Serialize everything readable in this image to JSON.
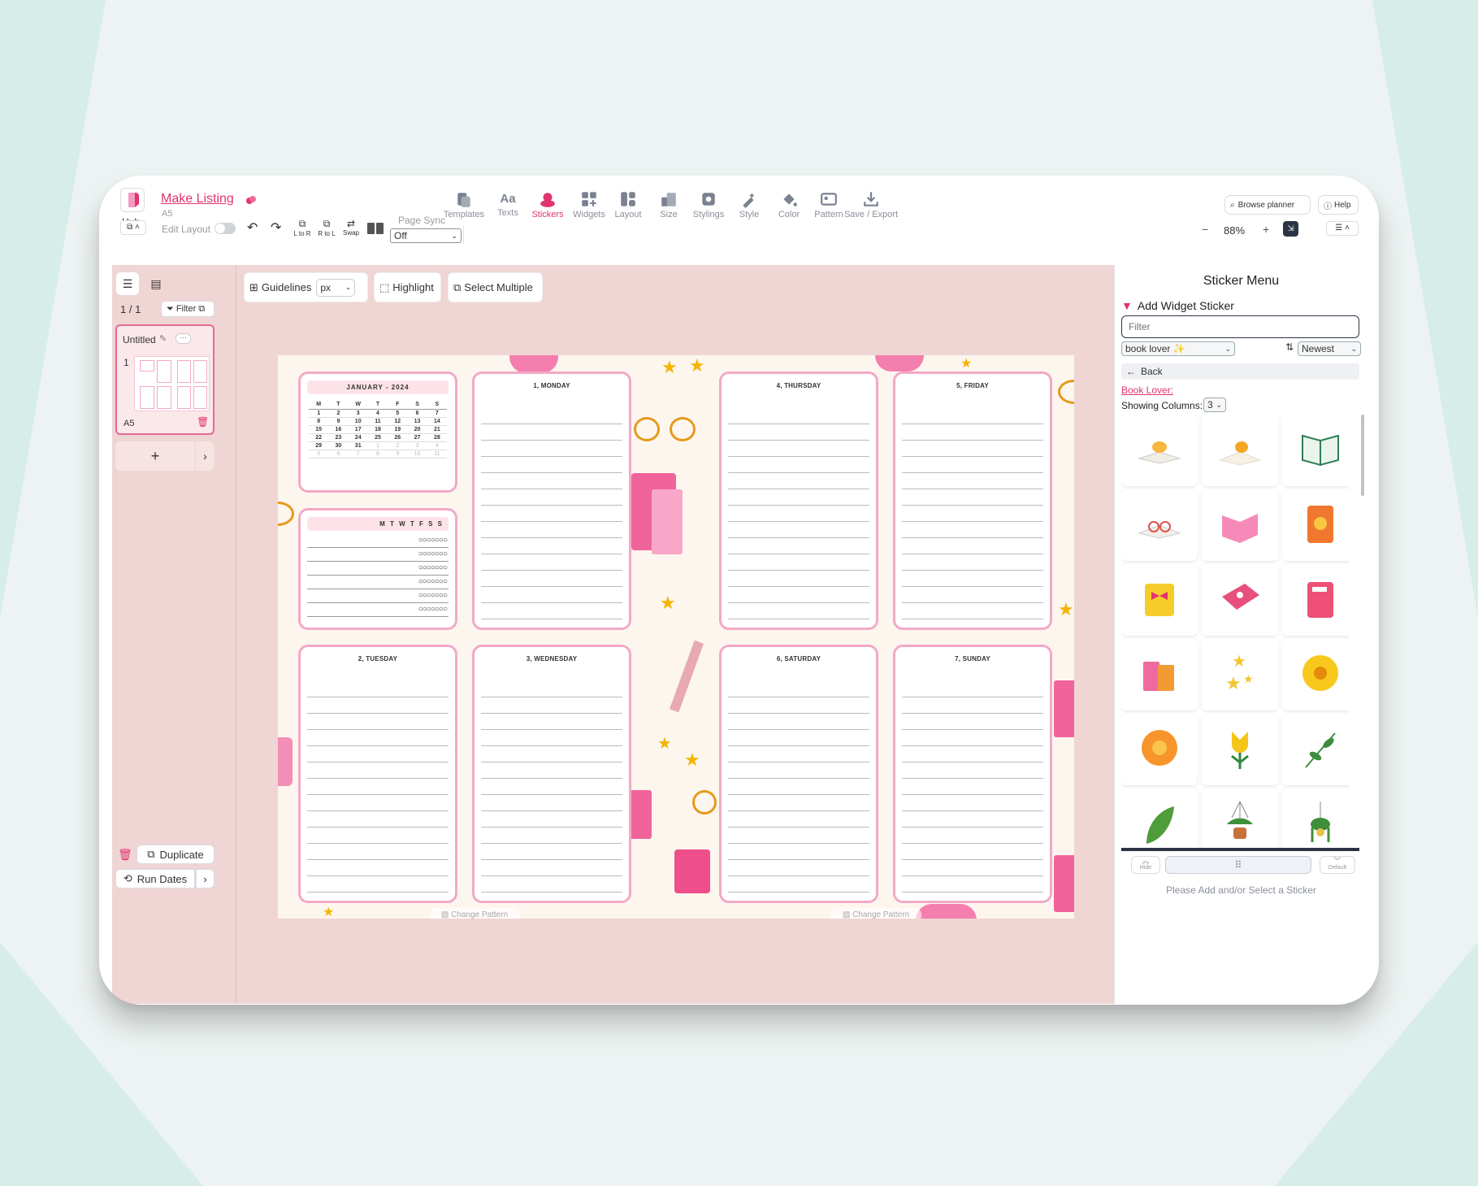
{
  "header": {
    "hub_label": "Hub",
    "project_title": "Make Listing",
    "page_size": "A5",
    "edit_layout_label": "Edit Layout",
    "l_to_r": "L to R",
    "r_to_l": "R to L",
    "swap": "Swap",
    "page_sync_label": "Page Sync",
    "page_sync_value": "Off",
    "browse_planner": "Browse planner",
    "help": "Help",
    "zoom": "88%",
    "zoom_minus": "−",
    "zoom_plus": "+"
  },
  "toolbar": [
    {
      "label": "Templates"
    },
    {
      "label": "Texts"
    },
    {
      "label": "Stickers"
    },
    {
      "label": "Widgets"
    },
    {
      "label": "Layout"
    },
    {
      "label": "Size"
    },
    {
      "label": "Stylings"
    },
    {
      "label": "Style"
    },
    {
      "label": "Color"
    },
    {
      "label": "Pattern"
    },
    {
      "label": "Save / Export"
    }
  ],
  "texts_icon": "Aa",
  "canvas_tools": {
    "guidelines": "Guidelines",
    "unit": "px",
    "highlight": "Highlight",
    "select_multiple": "Select Multiple"
  },
  "pages_panel": {
    "count": "1 / 1",
    "filter": "Filter",
    "page_name": "Untitled",
    "more": "···",
    "page_number": "1",
    "page_size": "A5",
    "add": "+",
    "duplicate": "Duplicate",
    "run_dates": "Run Dates"
  },
  "planner": {
    "calendar_title": "JANUARY - 2024",
    "weekdays": [
      "M",
      "T",
      "W",
      "T",
      "F",
      "S",
      "S"
    ],
    "calendar_rows": [
      [
        "1",
        "2",
        "3",
        "4",
        "5",
        "6",
        "7"
      ],
      [
        "8",
        "9",
        "10",
        "11",
        "12",
        "13",
        "14"
      ],
      [
        "15",
        "16",
        "17",
        "18",
        "19",
        "20",
        "21"
      ],
      [
        "22",
        "23",
        "24",
        "25",
        "26",
        "27",
        "28"
      ],
      [
        "29",
        "30",
        "31",
        "1",
        "2",
        "3",
        "4"
      ],
      [
        "5",
        "6",
        "7",
        "8",
        "9",
        "10",
        "11"
      ]
    ],
    "habit_header": "M T W T F S S",
    "habit_circles": "○○○○○○○",
    "days": [
      {
        "title": "1, MONDAY"
      },
      {
        "title": "2, TUESDAY"
      },
      {
        "title": "3, WEDNESDAY"
      },
      {
        "title": "4, THURSDAY"
      },
      {
        "title": "5, FRIDAY"
      },
      {
        "title": "6, SATURDAY"
      },
      {
        "title": "7, SUNDAY"
      }
    ],
    "change_pattern": "Change Pattern"
  },
  "sticker_menu": {
    "title": "Sticker Menu",
    "add_widget": "Add Widget Sticker",
    "filter_placeholder": "Filter",
    "category": "book lover ✨",
    "sort": "Newest",
    "back": "Back",
    "collection_title": "Book Lover:",
    "showing_columns_label": "Showing Columns:",
    "columns": "3",
    "hide": "Hide",
    "default": "Default",
    "footer_message": "Please Add and/or Select a Sticker",
    "stickers": [
      "book-tea-icon",
      "open-book-coffee-icon",
      "green-book-icon",
      "book-glasses-icon",
      "pink-book-icon",
      "orange-notebook-icon",
      "yellow-book-bow-icon",
      "pink-floral-book-icon",
      "pink-notebook-icon",
      "book-stack-icon",
      "stars-icon",
      "yellow-flower-icon",
      "orange-flower-icon",
      "tulip-icon",
      "branch-icon",
      "leaf-icon",
      "hanging-plant-icon",
      "hanging-ivy-icon",
      "potted-plant-icon",
      "pink-potted-plant-icon",
      "cat-books-icon"
    ]
  },
  "colors": {
    "accent": "#e2336f",
    "canvas_bg": "#efd5d3",
    "card_border": "#f2a9c7"
  }
}
